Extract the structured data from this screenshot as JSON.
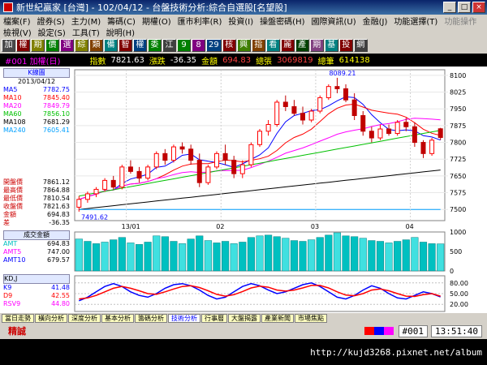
{
  "window": {
    "title": "新世紀贏家 [台灣] - 102/04/12 - 台盤技術分析:綜合自選股[名望股]"
  },
  "menu": {
    "row1": [
      "檔案(F)",
      "證券(S)",
      "主力(M)",
      "籌碼(C)",
      "期權(O)",
      "匯市利率(R)",
      "投資(I)",
      "操盤密碼(H)",
      "國際資訊(U)",
      "金融(J)",
      "功能選擇(T)",
      "功能操作"
    ],
    "row2": [
      "檢視(V)",
      "設定(S)",
      "工具(T)",
      "說明(H)"
    ]
  },
  "toolbar": [
    {
      "label": "加",
      "bg": "#4a4a4a"
    },
    {
      "label": "權",
      "bg": "#800000"
    },
    {
      "label": "期",
      "bg": "#808000"
    },
    {
      "label": "價",
      "bg": "#008000"
    },
    {
      "label": "選",
      "bg": "#800080"
    },
    {
      "label": "綜",
      "bg": "#808000"
    },
    {
      "label": "類",
      "bg": "#804000"
    },
    {
      "label": "備",
      "bg": "#008080"
    },
    {
      "label": "智",
      "bg": "#800000"
    },
    {
      "label": "權",
      "bg": "#004080"
    },
    {
      "label": "委",
      "bg": "#008000"
    },
    {
      "label": "江",
      "bg": "#404040"
    },
    {
      "label": "9",
      "bg": "#008000"
    },
    {
      "label": "8",
      "bg": "#800080"
    },
    {
      "label": "29",
      "bg": "#004080"
    },
    {
      "label": "核",
      "bg": "#800000"
    },
    {
      "label": "興",
      "bg": "#408000"
    },
    {
      "label": "指",
      "bg": "#804000"
    },
    {
      "label": "看",
      "bg": "#008080"
    },
    {
      "label": "麗",
      "bg": "#800000"
    },
    {
      "label": "產",
      "bg": "#004000"
    },
    {
      "label": "期",
      "bg": "#804080"
    },
    {
      "label": "基",
      "bg": "#008080"
    },
    {
      "label": "投",
      "bg": "#800000"
    },
    {
      "label": "網",
      "bg": "#404040"
    }
  ],
  "quote": {
    "code": "#001 加權(日)",
    "index_label": "指數",
    "index": "7821.63",
    "change_label": "漲跌",
    "change": "-36.35",
    "amount_label": "金額",
    "amount": "694.83",
    "vol_label": "總張",
    "vol": "3069819",
    "count_label": "總筆",
    "count": "614138"
  },
  "kline": {
    "title": "K線圖",
    "date": "2013/04/12",
    "high_label": "8089.21",
    "low_label": "7491.62"
  },
  "ma_list": [
    {
      "name": "MA5",
      "value": "7782.75",
      "color": "#0000ff"
    },
    {
      "name": "MA10",
      "value": "7845.40",
      "color": "#ff0000"
    },
    {
      "name": "MA20",
      "value": "7849.79",
      "color": "#ff00ff"
    },
    {
      "name": "MA60",
      "value": "7856.10",
      "color": "#00c000"
    },
    {
      "name": "MA108",
      "value": "7681.29",
      "color": "#000000"
    },
    {
      "name": "MA240",
      "value": "7605.41",
      "color": "#00a0ff"
    }
  ],
  "ohlc_list": [
    {
      "name": "開盤價",
      "value": "7861.12"
    },
    {
      "name": "最高價",
      "value": "7864.88"
    },
    {
      "name": "最低價",
      "value": "7810.54"
    },
    {
      "name": "收盤價",
      "value": "7821.63"
    },
    {
      "name": "金額",
      "value": "694.83"
    },
    {
      "name": "差",
      "value": "-36.35"
    }
  ],
  "price_axis": [
    "8100",
    "8025",
    "7950",
    "7875",
    "7800",
    "7725",
    "7650",
    "7575",
    "7500"
  ],
  "date_axis": [
    "13/01",
    "02",
    "03",
    "04"
  ],
  "amount_panel": {
    "title": "成交金額",
    "items": [
      {
        "name": "AMT",
        "value": "694.83"
      },
      {
        "name": "AMT5",
        "value": "747.00"
      },
      {
        "name": "AMT10",
        "value": "679.57"
      }
    ],
    "axis": [
      "1000",
      "500",
      "0"
    ]
  },
  "kdj_panel": {
    "title": "KD,J",
    "items": [
      {
        "name": "K9",
        "value": "41.48",
        "color": "#0000ff"
      },
      {
        "name": "D9",
        "value": "42.55",
        "color": "#ff0000"
      },
      {
        "name": "RSV9",
        "value": "44.80",
        "color": "#ff00ff"
      }
    ],
    "axis": [
      "80.00",
      "50.00",
      "20.00"
    ]
  },
  "tabs": [
    "當日走勢",
    "橫向分析",
    "深度分析",
    "基本分析",
    "籌碼分析",
    "技術分析",
    "行事曆",
    "大盤揭露",
    "產業新聞",
    "市場焦點"
  ],
  "active_tab": "技術分析",
  "status": {
    "mode": "精誠",
    "code": "#001",
    "time": "13:51:40"
  },
  "url": "http://kujd3268.pixnet.net/album",
  "chart_data": {
    "type": "candlestick",
    "price_range": [
      7450,
      8125
    ],
    "candles": [
      [
        7510,
        7560,
        7490,
        7545
      ],
      [
        7545,
        7580,
        7530,
        7570
      ],
      [
        7570,
        7600,
        7555,
        7590
      ],
      [
        7590,
        7640,
        7580,
        7630
      ],
      [
        7630,
        7650,
        7590,
        7600
      ],
      [
        7600,
        7700,
        7590,
        7690
      ],
      [
        7690,
        7720,
        7660,
        7670
      ],
      [
        7670,
        7690,
        7620,
        7640
      ],
      [
        7640,
        7700,
        7630,
        7690
      ],
      [
        7690,
        7760,
        7680,
        7750
      ],
      [
        7750,
        7770,
        7700,
        7720
      ],
      [
        7720,
        7790,
        7710,
        7780
      ],
      [
        7780,
        7800,
        7750,
        7770
      ],
      [
        7770,
        7790,
        7700,
        7720
      ],
      [
        7720,
        7750,
        7600,
        7620
      ],
      [
        7620,
        7700,
        7610,
        7690
      ],
      [
        7690,
        7760,
        7680,
        7750
      ],
      [
        7750,
        7790,
        7700,
        7720
      ],
      [
        7720,
        7740,
        7640,
        7660
      ],
      [
        7660,
        7720,
        7640,
        7700
      ],
      [
        7700,
        7800,
        7690,
        7790
      ],
      [
        7790,
        7860,
        7780,
        7850
      ],
      [
        7850,
        7900,
        7830,
        7880
      ],
      [
        7880,
        7990,
        7870,
        7980
      ],
      [
        7980,
        8010,
        7940,
        7960
      ],
      [
        7960,
        7990,
        7920,
        7930
      ],
      [
        7930,
        7960,
        7880,
        7900
      ],
      [
        7900,
        7950,
        7890,
        7940
      ],
      [
        7940,
        8010,
        7930,
        8000
      ],
      [
        8000,
        8060,
        7990,
        8050
      ],
      [
        8050,
        8089,
        8020,
        8040
      ],
      [
        8040,
        8060,
        7980,
        7990
      ],
      [
        7990,
        8020,
        7900,
        7920
      ],
      [
        7920,
        7940,
        7830,
        7850
      ],
      [
        7850,
        7870,
        7800,
        7820
      ],
      [
        7820,
        7880,
        7810,
        7860
      ],
      [
        7860,
        7880,
        7830,
        7840
      ],
      [
        7840,
        7900,
        7830,
        7890
      ],
      [
        7890,
        7910,
        7850,
        7870
      ],
      [
        7870,
        7890,
        7780,
        7800
      ],
      [
        7800,
        7810,
        7730,
        7750
      ],
      [
        7750,
        7820,
        7740,
        7810
      ],
      [
        7861,
        7865,
        7811,
        7822
      ]
    ],
    "amount": [
      820,
      760,
      700,
      740,
      800,
      860,
      720,
      680,
      740,
      900,
      880,
      760,
      700,
      820,
      900,
      780,
      720,
      760,
      700,
      740,
      860,
      900,
      920,
      880,
      840,
      780,
      760,
      800,
      860,
      920,
      980,
      900,
      880,
      840,
      780,
      760,
      720,
      760,
      800,
      860,
      740,
      700,
      695
    ],
    "k": [
      30,
      40,
      55,
      70,
      78,
      70,
      55,
      45,
      40,
      50,
      65,
      75,
      78,
      72,
      60,
      45,
      35,
      40,
      55,
      70,
      78,
      72,
      60,
      50,
      55,
      65,
      75,
      80,
      70,
      55,
      40,
      35,
      45,
      60,
      72,
      65,
      50,
      38,
      35,
      45,
      55,
      50,
      41
    ],
    "d": [
      35,
      38,
      45,
      55,
      65,
      70,
      65,
      58,
      50,
      48,
      55,
      63,
      70,
      72,
      67,
      58,
      48,
      43,
      47,
      56,
      66,
      71,
      68,
      60,
      57,
      60,
      66,
      73,
      73,
      66,
      55,
      46,
      44,
      50,
      60,
      63,
      58,
      50,
      43,
      42,
      47,
      50,
      43
    ]
  }
}
